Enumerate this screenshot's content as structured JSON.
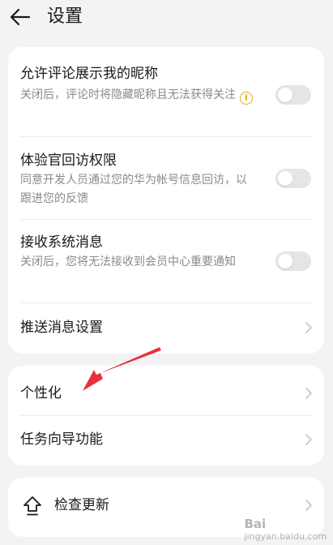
{
  "header": {
    "title": "设置"
  },
  "card1": {
    "items": [
      {
        "title": "允许评论展示我的昵称",
        "desc": "关闭后，评论时将隐藏昵称且无法获得关注",
        "toggle_on": false,
        "has_info_icon": true
      },
      {
        "title": "体验官回访权限",
        "desc": "同意开发人员通过您的华为帐号信息回访，以跟进您的反馈",
        "toggle_on": false
      },
      {
        "title": "接收系统消息",
        "desc": "关闭后，您将无法接收到会员中心重要通知",
        "toggle_on": false
      },
      {
        "title": "推送消息设置"
      }
    ]
  },
  "card2": {
    "items": [
      {
        "title": "个性化"
      },
      {
        "title": "任务向导功能"
      }
    ]
  },
  "card3": {
    "items": [
      {
        "title": "检查更新",
        "icon": "upload-arrow-icon"
      }
    ]
  },
  "watermark": {
    "text": "Bai",
    "sub": "jingyan.baidu.com"
  },
  "colors": {
    "background": "#f1f3f5",
    "card": "#ffffff",
    "toggle_off": "#e5e5e5",
    "info_icon": "#e0a920",
    "annotation_arrow": "#e8313a"
  }
}
